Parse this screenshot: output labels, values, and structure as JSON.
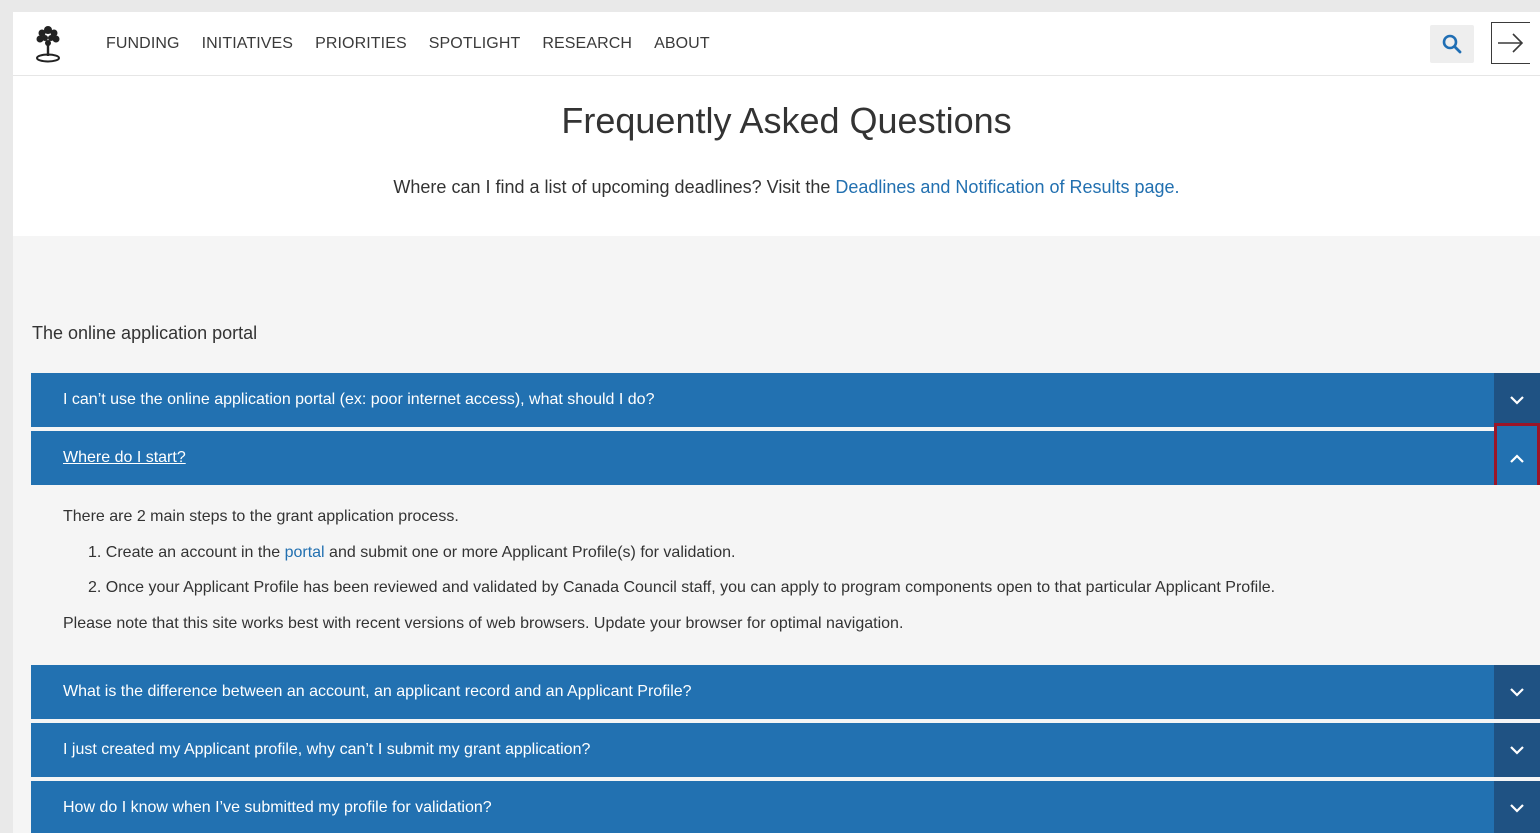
{
  "nav": {
    "items": [
      {
        "label": "FUNDING"
      },
      {
        "label": "INITIATIVES"
      },
      {
        "label": "PRIORITIES"
      },
      {
        "label": "SPOTLIGHT"
      },
      {
        "label": "RESEARCH"
      },
      {
        "label": "ABOUT"
      }
    ],
    "icons": {
      "logo": "tree-logo-icon",
      "search": "search-icon",
      "login": "sign-in-arrow-icon"
    }
  },
  "hero": {
    "title": "Frequently Asked Questions",
    "note_prefix": "Where can I find a list of upcoming deadlines? Visit the ",
    "note_link": "Deadlines and Notification of Results page."
  },
  "section": {
    "title": "The online application portal"
  },
  "faqs": [
    {
      "question": "I can’t use the online application portal (ex: poor internet access), what should I do?",
      "expanded": false
    },
    {
      "question": "Where do I start?",
      "expanded": true
    },
    {
      "question": "What is the difference between an account, an applicant record and an Applicant Profile?",
      "expanded": false
    },
    {
      "question": "I just created my Applicant profile, why can’t I submit my grant application?",
      "expanded": false
    },
    {
      "question": "How do I know when I’ve submitted my profile for validation?",
      "expanded": false
    }
  ],
  "answer": {
    "intro": "There are 2 main steps to the grant application process.",
    "step1_num": "1.",
    "step1_prefix": "Create an account in the ",
    "step1_link": "portal",
    "step1_suffix": " and submit one or more Applicant Profile(s) for validation.",
    "step2_num": "2.",
    "step2": "Once your Applicant Profile has been reviewed and validated by Canada Council staff, you can apply to program components open to that particular Applicant Profile.",
    "note": "Please note that this site works best with recent versions of web browsers. Update your browser for optimal navigation."
  },
  "colors": {
    "accent": "#2271b1",
    "toggle": "#1f5283",
    "link": "#2270b0",
    "highlight": "#9b1528"
  }
}
